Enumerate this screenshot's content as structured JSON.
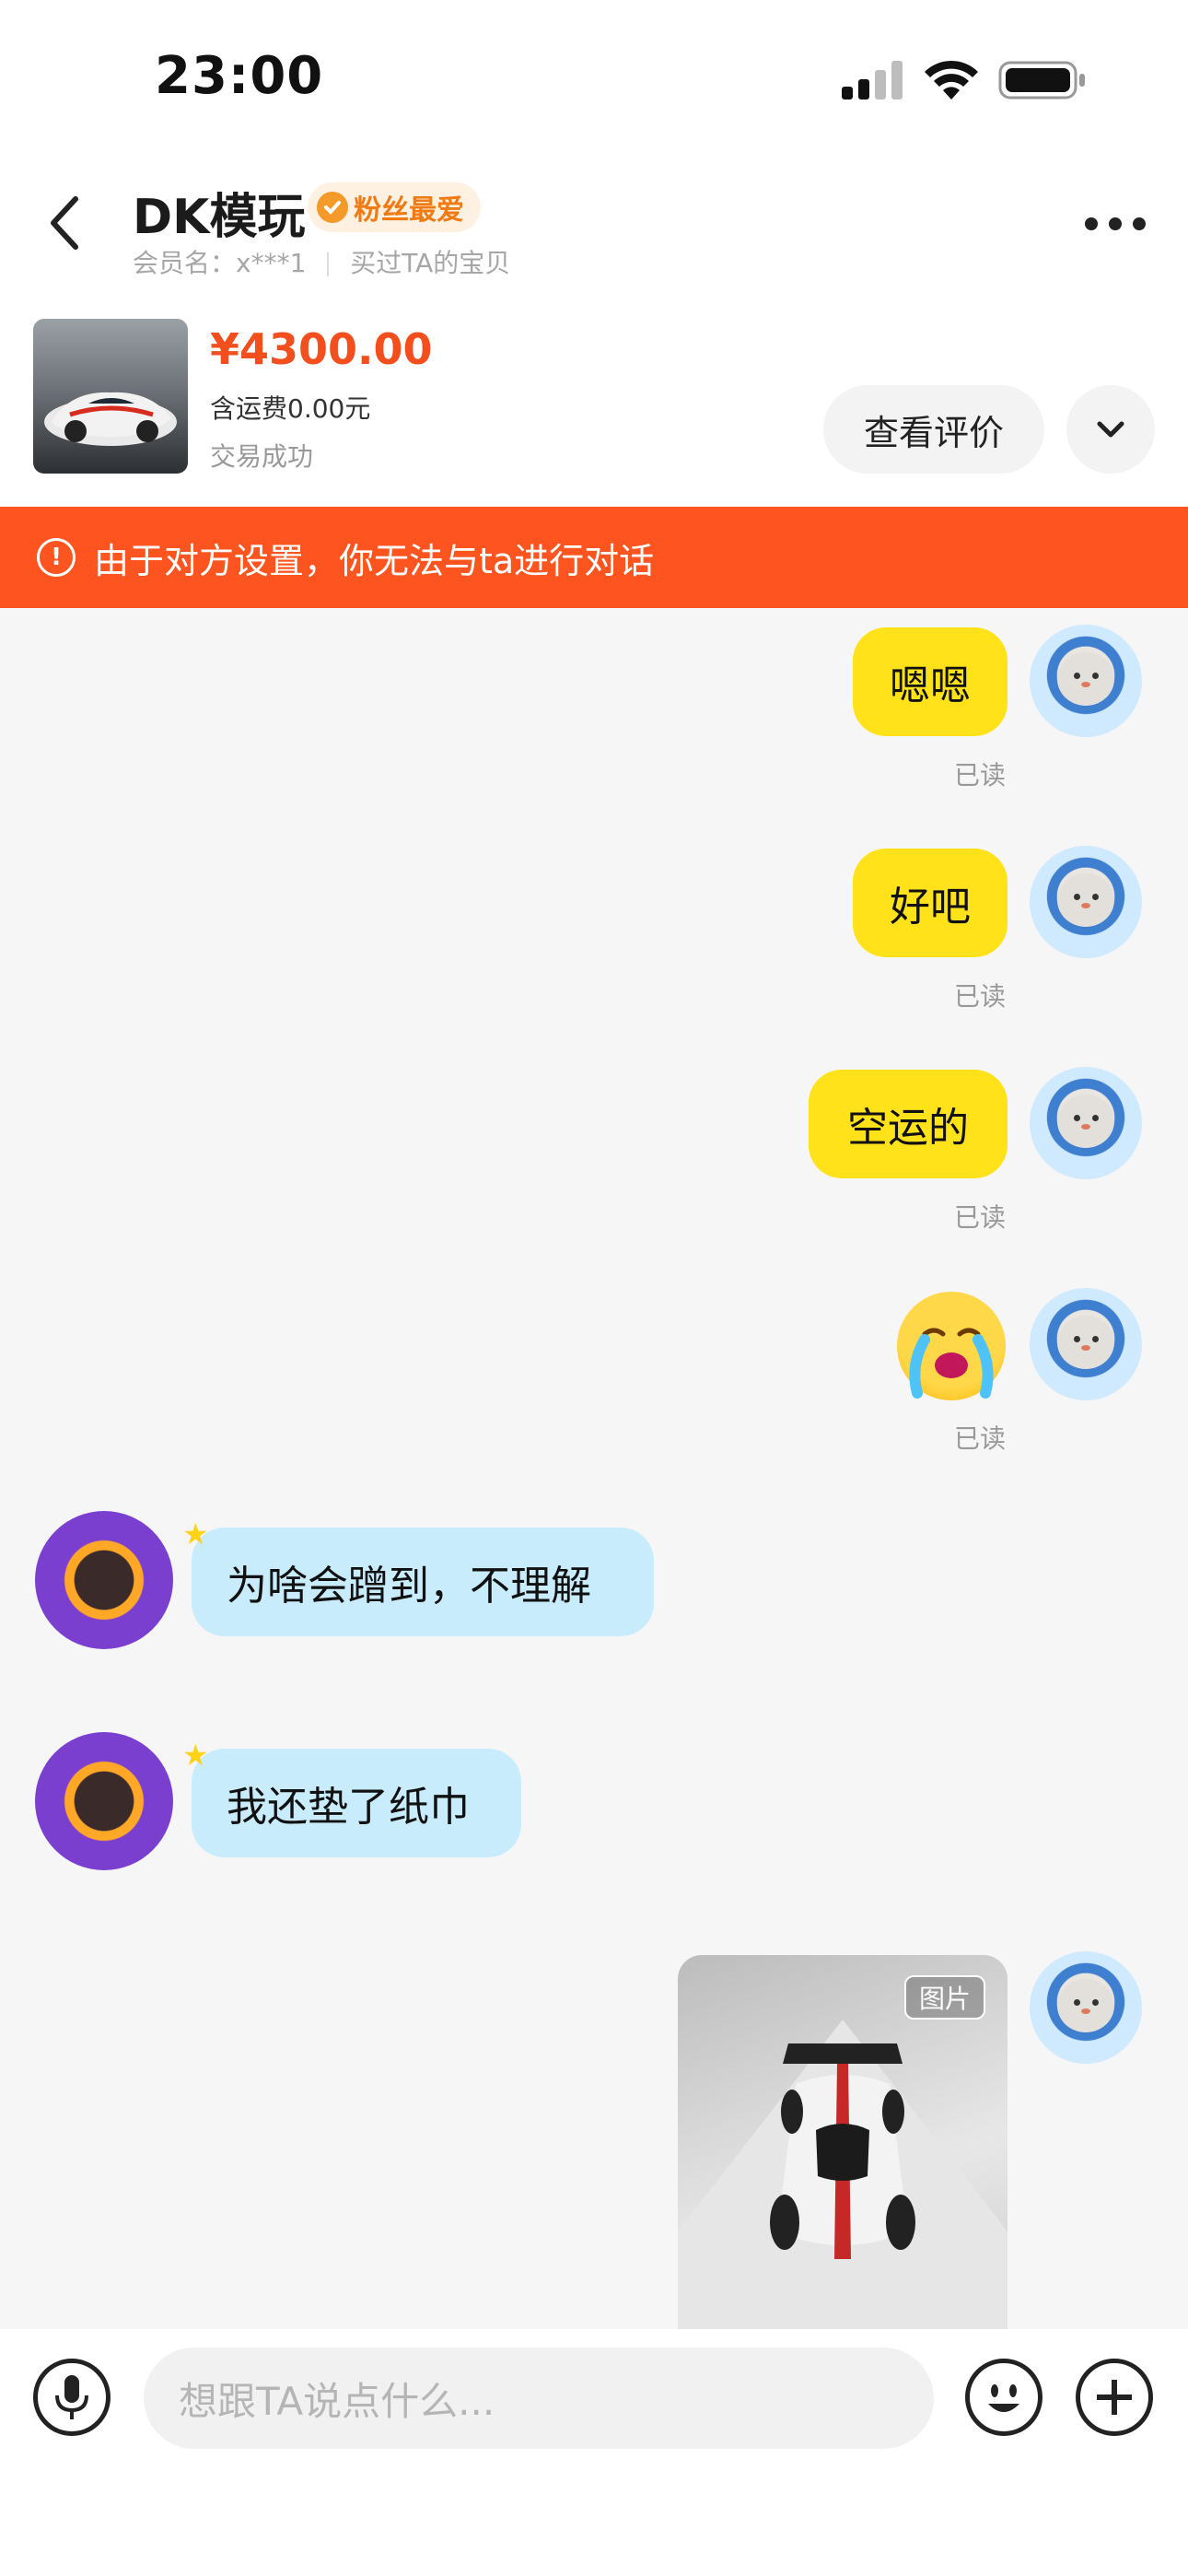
{
  "status_bar": {
    "time": "23:00"
  },
  "header": {
    "shop_name": "DK模玩",
    "badge": "粉丝最爱",
    "member_label": "会员名：x***1",
    "member_note": "买过TA的宝贝"
  },
  "order": {
    "price": "¥4300.00",
    "shipping": "含运费0.00元",
    "status": "交易成功",
    "review_button": "查看评价"
  },
  "banner": {
    "text": "由于对方设置，你无法与ta进行对话"
  },
  "messages": [
    {
      "from": "me",
      "text": "嗯嗯",
      "read": "已读"
    },
    {
      "from": "me",
      "text": "好吧",
      "read": "已读"
    },
    {
      "from": "me",
      "text": "空运的",
      "read": "已读"
    },
    {
      "from": "me",
      "emoji": "crying-face",
      "read": "已读"
    },
    {
      "from": "them",
      "text": "为啥会蹭到，不理解"
    },
    {
      "from": "them",
      "text": "我还垫了纸巾"
    },
    {
      "from": "me",
      "image_tag": "图片"
    }
  ],
  "input": {
    "placeholder": "想跟TA说点什么..."
  },
  "colors": {
    "accent": "#fe5520",
    "my_bubble": "#ffe21a",
    "their_bubble": "#c8ecfb",
    "price": "#f24e1e",
    "badge_text": "#f07a14"
  }
}
